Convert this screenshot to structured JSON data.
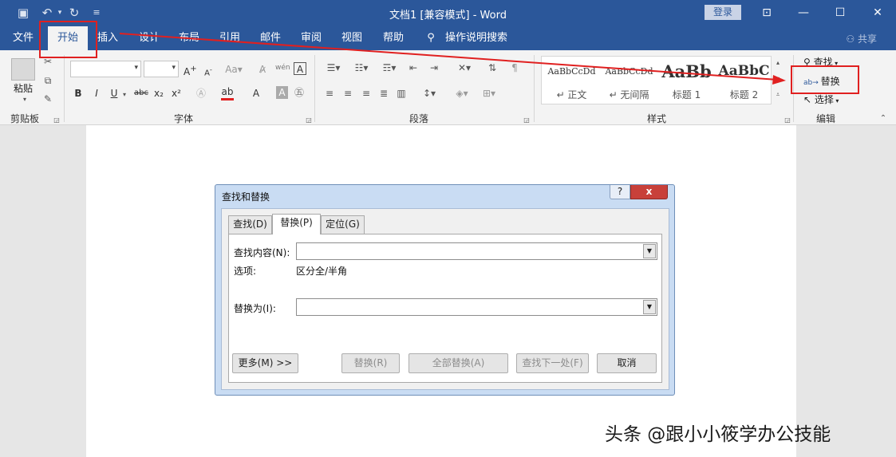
{
  "titlebar": {
    "title": "文档1 [兼容模式]  -  Word",
    "login": "登录",
    "icons": [
      "save-icon",
      "undo-icon",
      "redo-icon",
      "customize-qat-icon"
    ]
  },
  "tabs": [
    "文件",
    "开始",
    "插入",
    "设计",
    "布局",
    "引用",
    "邮件",
    "审阅",
    "视图",
    "帮助"
  ],
  "tell_me": "操作说明搜索",
  "share": "共享",
  "ribbon": {
    "clipboard": {
      "paste": "粘贴",
      "label": "剪贴板"
    },
    "font": {
      "label": "字体",
      "buttons": [
        "B",
        "I",
        "U",
        "abc",
        "x₂",
        "x²"
      ]
    },
    "paragraph": {
      "label": "段落"
    },
    "styles": {
      "label": "样式",
      "items": [
        {
          "sample": "AaBbCcDd",
          "name": "↵ 正文"
        },
        {
          "sample": "AaBbCcDd",
          "name": "↵ 无间隔"
        },
        {
          "sample": "AaBb",
          "name": "标题 1"
        },
        {
          "sample": "AaBbC",
          "name": "标题 2"
        }
      ]
    },
    "editing": {
      "label": "编辑",
      "find": "查找",
      "replace": "替换",
      "select": "选择"
    }
  },
  "dialog": {
    "title": "查找和替换",
    "help": "?",
    "close": "x",
    "tabs": [
      "查找(D)",
      "替换(P)",
      "定位(G)"
    ],
    "find_label": "查找内容(N):",
    "find_value": "",
    "options_label": "选项:",
    "options_value": "区分全/半角",
    "replace_label": "替换为(I):",
    "replace_value": "",
    "buttons": {
      "more": "更多(M) >>",
      "replace": "替换(R)",
      "replace_all": "全部替换(A)",
      "find_next": "查找下一处(F)",
      "cancel": "取消"
    }
  },
  "watermark": "头条 @跟小小筱学办公技能",
  "colors": {
    "word_blue": "#2b579a",
    "annotation_red": "#e02020"
  }
}
